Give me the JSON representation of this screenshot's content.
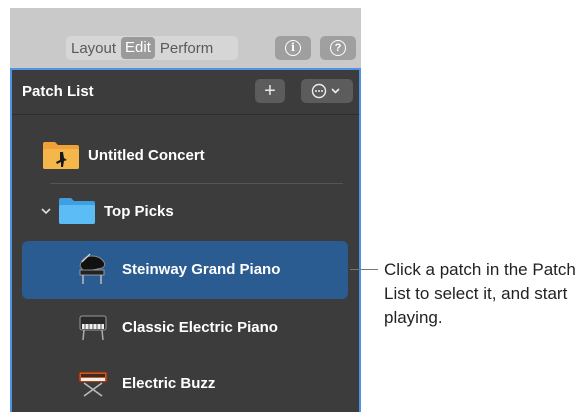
{
  "toolbar": {
    "modes": [
      "Layout",
      "Edit",
      "Perform"
    ],
    "active_mode": "Edit",
    "info_icon": "info-icon",
    "help_icon": "help-icon"
  },
  "patch_list": {
    "title": "Patch List",
    "add_button": "+",
    "items": [
      {
        "label": "Untitled Concert",
        "icon": "concert-folder-icon"
      },
      {
        "label": "Top Picks",
        "icon": "folder-icon"
      },
      {
        "label": "Steinway Grand Piano",
        "icon": "grand-piano-icon",
        "selected": true
      },
      {
        "label": "Classic Electric Piano",
        "icon": "electric-piano-icon"
      },
      {
        "label": "Electric Buzz",
        "icon": "synth-icon"
      }
    ]
  },
  "callout": {
    "text": "Click a patch in the Patch List to select it, and start playing."
  },
  "colors": {
    "panel_bg": "#3c3c3c",
    "selection": "#2a5c92",
    "focus_border": "#4e93e8",
    "folder_blue": "#58b6f2",
    "folder_orange": "#f0a238"
  }
}
